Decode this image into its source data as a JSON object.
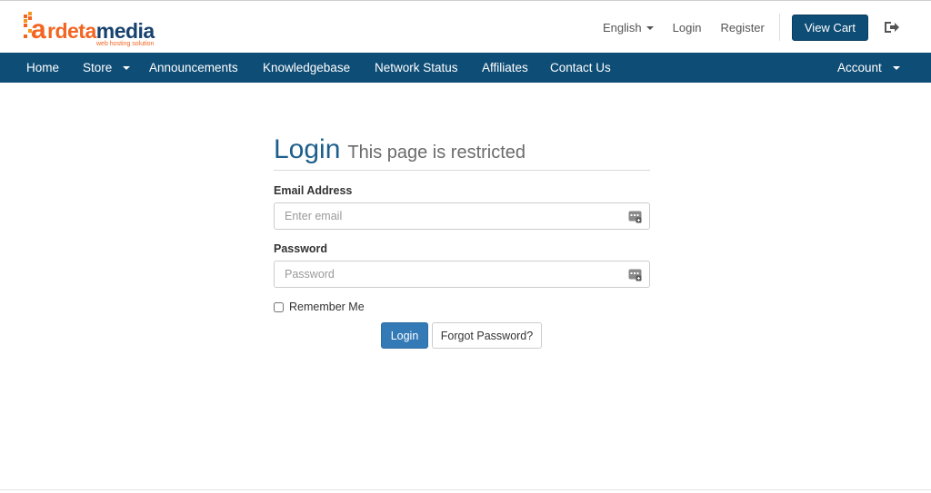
{
  "brand": {
    "logo_prefix": "a",
    "logo_word_1": "rdeta",
    "logo_word_2": "media",
    "tagline": "web hosting solution",
    "colors": {
      "orange": "#f26522",
      "navy": "#17426e",
      "nav_bg": "#0e4d76",
      "accent_blue": "#337ab7"
    }
  },
  "top_links": {
    "language": "English",
    "login": "Login",
    "register": "Register",
    "view_cart": "View Cart",
    "logout_icon": "logout-icon"
  },
  "nav": {
    "items": [
      {
        "label": "Home"
      },
      {
        "label": "Store"
      },
      {
        "label": "Announcements"
      },
      {
        "label": "Knowledgebase"
      },
      {
        "label": "Network Status"
      },
      {
        "label": "Affiliates"
      },
      {
        "label": "Contact Us"
      }
    ],
    "account": "Account"
  },
  "login": {
    "title": "Login",
    "subtitle": "This page is restricted",
    "email_label": "Email Address",
    "email_placeholder": "Enter email",
    "email_value": "",
    "password_label": "Password",
    "password_placeholder": "Password",
    "password_value": "",
    "remember_label": "Remember Me",
    "remember_checked": false,
    "login_button": "Login",
    "forgot_button": "Forgot Password?",
    "field_icon": "password-manager-icon"
  }
}
